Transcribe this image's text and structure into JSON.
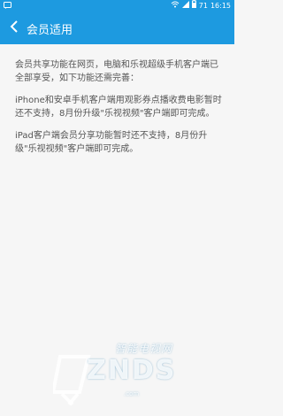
{
  "status_bar": {
    "battery_text": "71",
    "time": "16:15",
    "icons": [
      "message-icon",
      "signal-icon",
      "wifi-icon",
      "battery-icon"
    ]
  },
  "header": {
    "title": "会员适用",
    "back_icon": "chevron-left-icon"
  },
  "content": {
    "paragraphs": [
      "会员共享功能在网页，电脑和乐视超级手机客户端已全部享受，如下功能还需完善：",
      "iPhone和安卓手机客户端用观影券点播收费电影暂时还不支持，8月份升级\"乐视视频\"客户端即可完成。",
      "iPad客户端会员分享功能暂时还不支持，8月份升级\"乐视视频\"客户端即可完成。"
    ]
  },
  "watermark": {
    "cn": "智能电视网",
    "en": "ZNDS",
    "sub": ".com"
  },
  "colors": {
    "primary": "#1d9ae0",
    "background": "#f6f6f6",
    "text": "#555555"
  }
}
